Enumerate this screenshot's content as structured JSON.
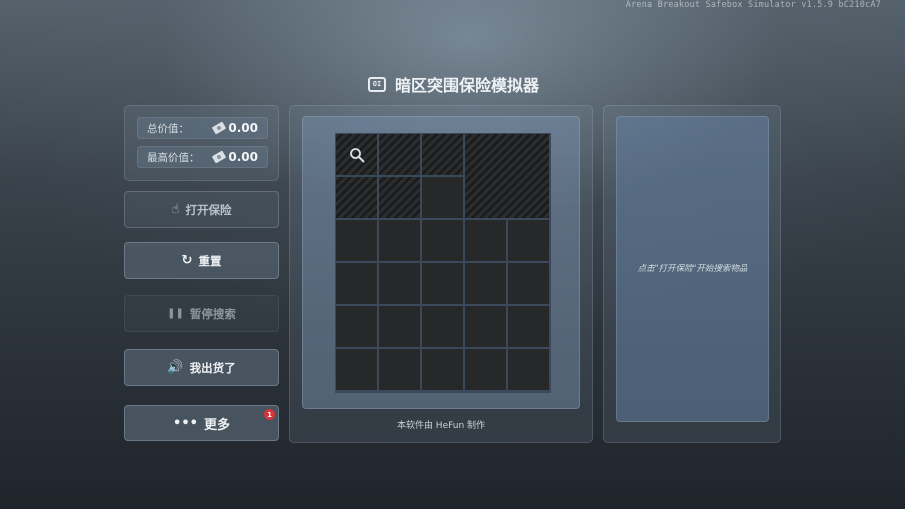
{
  "version": "Arena Breakout Safebox Simulator v1.5.9  bC210cA7",
  "header": {
    "logo_text": "OI",
    "title": "暗区突围保险模拟器"
  },
  "stats": {
    "total_label": "总价值：",
    "total_value": "0.00",
    "max_label": "最高价值：",
    "max_value": "0.00",
    "icon": "cash-icon"
  },
  "buttons": {
    "open": {
      "label": "打开保险",
      "icon": "pointer-hand-icon"
    },
    "reset": {
      "label": "重置",
      "icon": "refresh-icon"
    },
    "pause": {
      "label": "暂停搜索",
      "icon": "pause-icon"
    },
    "sell": {
      "label": "我出货了",
      "icon": "speaker-icon"
    },
    "more": {
      "label": "更多",
      "icon": "more-icon",
      "badge": "1"
    }
  },
  "grid": {
    "cols": 5,
    "rows": 6
  },
  "credit": "本软件由 HeFun 制作",
  "hint": "点击\"打开保险\"开始搜索物品",
  "colors": {
    "accent_badge": "#d8323a",
    "grid_cell": "#262829",
    "grid_line": "#3a4a5c"
  }
}
